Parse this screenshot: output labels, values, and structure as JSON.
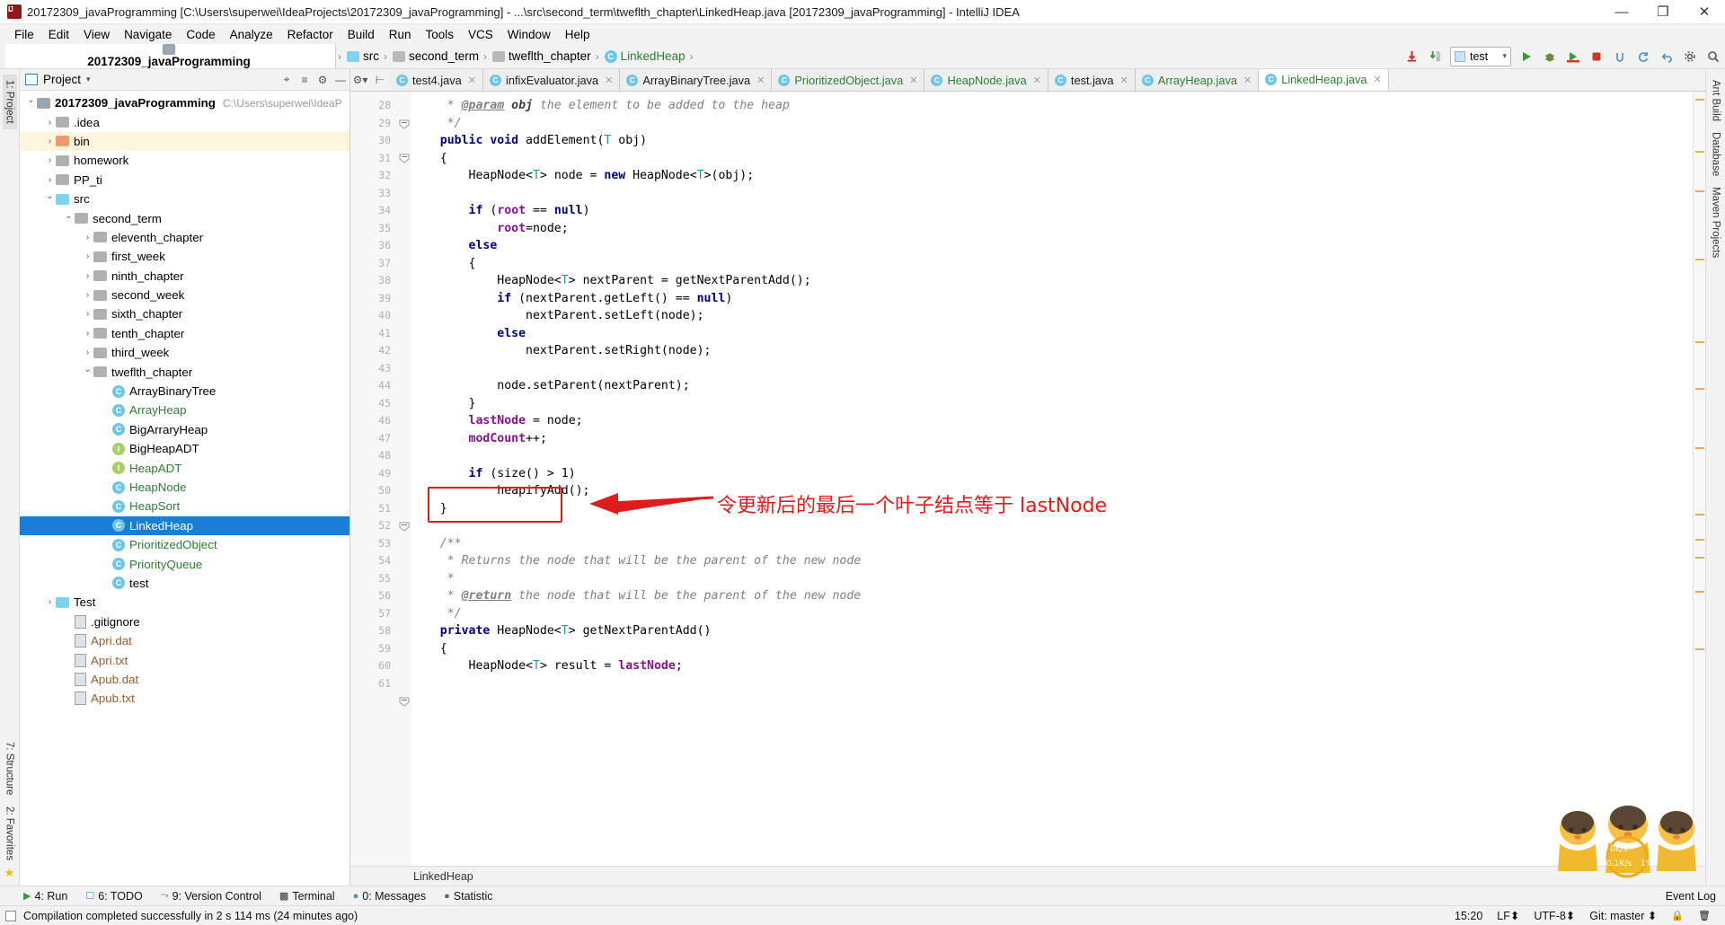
{
  "window": {
    "title": "20172309_javaProgramming [C:\\Users\\superwei\\IdeaProjects\\20172309_javaProgramming] - ...\\src\\second_term\\tweflth_chapter\\LinkedHeap.java [20172309_javaProgramming] - IntelliJ IDEA",
    "minimize": "—",
    "maximize": "❐",
    "close": "✕",
    "app_icon": "intellij-idea-icon"
  },
  "menu": [
    {
      "label": "File"
    },
    {
      "label": "Edit"
    },
    {
      "label": "View"
    },
    {
      "label": "Navigate"
    },
    {
      "label": "Code"
    },
    {
      "label": "Analyze"
    },
    {
      "label": "Refactor"
    },
    {
      "label": "Build"
    },
    {
      "label": "Run"
    },
    {
      "label": "Tools"
    },
    {
      "label": "VCS"
    },
    {
      "label": "Window"
    },
    {
      "label": "Help"
    }
  ],
  "navbar": {
    "crumbs": [
      {
        "label": "20172309_javaProgramming",
        "kind": "project"
      },
      {
        "label": "src",
        "kind": "source"
      },
      {
        "label": "second_term",
        "kind": "folder"
      },
      {
        "label": "tweflth_chapter",
        "kind": "folder"
      },
      {
        "label": "LinkedHeap",
        "kind": "class"
      }
    ],
    "separator": "›",
    "run_config": "test",
    "icons": [
      "update-project-icon",
      "commit-icon",
      "run-icon",
      "debug-icon",
      "run-with-coverage-icon",
      "stop-icon",
      "attach-profiler-icon",
      "sync-icon",
      "undo-icon",
      "settings-icon",
      "search-icon"
    ]
  },
  "left_rail": [
    {
      "label": "1: Project",
      "selected": true
    },
    {
      "label": "7: Structure",
      "selected": false
    },
    {
      "label": "2: Favorites",
      "selected": false
    }
  ],
  "right_rail": [
    {
      "label": "Ant Build"
    },
    {
      "label": "Database"
    },
    {
      "label": "Maven Projects"
    }
  ],
  "project_panel": {
    "title": "Project",
    "dropdown": "▾",
    "buttons": [
      "locate-icon",
      "collapse-all-icon",
      "settings-icon",
      "hide-icon"
    ],
    "tree": [
      {
        "depth": 0,
        "arrow": "open",
        "icon": "module",
        "label": "20172309_javaProgramming",
        "bold": true,
        "path": "C:\\Users\\superwei\\IdeaP"
      },
      {
        "depth": 1,
        "arrow": "closed",
        "icon": "folder-grey",
        "label": ".idea"
      },
      {
        "depth": 1,
        "arrow": "closed",
        "icon": "folder-orange",
        "label": "bin",
        "highlight": true
      },
      {
        "depth": 1,
        "arrow": "closed",
        "icon": "folder-grey",
        "label": "homework"
      },
      {
        "depth": 1,
        "arrow": "closed",
        "icon": "folder-grey",
        "label": "PP_ti"
      },
      {
        "depth": 1,
        "arrow": "open",
        "icon": "folder-src",
        "label": "src"
      },
      {
        "depth": 2,
        "arrow": "open",
        "icon": "folder-pkg",
        "label": "second_term"
      },
      {
        "depth": 3,
        "arrow": "closed",
        "icon": "folder-pkg",
        "label": "eleventh_chapter"
      },
      {
        "depth": 3,
        "arrow": "closed",
        "icon": "folder-pkg",
        "label": "first_week"
      },
      {
        "depth": 3,
        "arrow": "closed",
        "icon": "folder-pkg",
        "label": "ninth_chapter"
      },
      {
        "depth": 3,
        "arrow": "closed",
        "icon": "folder-pkg",
        "label": "second_week"
      },
      {
        "depth": 3,
        "arrow": "closed",
        "icon": "folder-pkg",
        "label": "sixth_chapter"
      },
      {
        "depth": 3,
        "arrow": "closed",
        "icon": "folder-pkg",
        "label": "tenth_chapter"
      },
      {
        "depth": 3,
        "arrow": "closed",
        "icon": "folder-pkg",
        "label": "third_week"
      },
      {
        "depth": 3,
        "arrow": "open",
        "icon": "folder-pkg",
        "label": "tweflth_chapter"
      },
      {
        "depth": 4,
        "arrow": "none",
        "icon": "class",
        "label": "ArrayBinaryTree"
      },
      {
        "depth": 4,
        "arrow": "none",
        "icon": "class",
        "label": "ArrayHeap",
        "green": true
      },
      {
        "depth": 4,
        "arrow": "none",
        "icon": "class",
        "label": "BigArraryHeap"
      },
      {
        "depth": 4,
        "arrow": "none",
        "icon": "interface",
        "label": "BigHeapADT"
      },
      {
        "depth": 4,
        "arrow": "none",
        "icon": "interface",
        "label": "HeapADT",
        "green": true
      },
      {
        "depth": 4,
        "arrow": "none",
        "icon": "class",
        "label": "HeapNode",
        "green": true
      },
      {
        "depth": 4,
        "arrow": "none",
        "icon": "class",
        "label": "HeapSort",
        "green": true
      },
      {
        "depth": 4,
        "arrow": "none",
        "icon": "class",
        "label": "LinkedHeap",
        "selected": true
      },
      {
        "depth": 4,
        "arrow": "none",
        "icon": "class",
        "label": "PrioritizedObject",
        "green": true
      },
      {
        "depth": 4,
        "arrow": "none",
        "icon": "class",
        "label": "PriorityQueue",
        "green": true
      },
      {
        "depth": 4,
        "arrow": "none",
        "icon": "class-runnable",
        "label": "test"
      },
      {
        "depth": 1,
        "arrow": "closed",
        "icon": "folder-src",
        "label": "Test"
      },
      {
        "depth": 2,
        "arrow": "none",
        "icon": "file",
        "label": ".gitignore"
      },
      {
        "depth": 2,
        "arrow": "none",
        "icon": "file",
        "label": "Apri.dat",
        "brown": true
      },
      {
        "depth": 2,
        "arrow": "none",
        "icon": "file",
        "label": "Apri.txt",
        "brown": true
      },
      {
        "depth": 2,
        "arrow": "none",
        "icon": "file",
        "label": "Apub.dat",
        "brown": true
      },
      {
        "depth": 2,
        "arrow": "none",
        "icon": "file",
        "label": "Apub.txt",
        "brown": true
      }
    ]
  },
  "editor_tabs": [
    {
      "label": "test4.java",
      "icon": "class-runnable",
      "green": false,
      "active": false
    },
    {
      "label": "infixEvaluator.java",
      "icon": "class",
      "green": false,
      "active": false
    },
    {
      "label": "ArrayBinaryTree.java",
      "icon": "class",
      "green": false,
      "active": false
    },
    {
      "label": "PrioritizedObject.java",
      "icon": "class",
      "green": true,
      "active": false
    },
    {
      "label": "HeapNode.java",
      "icon": "class",
      "green": true,
      "active": false
    },
    {
      "label": "test.java",
      "icon": "class-runnable",
      "green": false,
      "active": false
    },
    {
      "label": "ArrayHeap.java",
      "icon": "class",
      "green": true,
      "active": false
    },
    {
      "label": "LinkedHeap.java",
      "icon": "class",
      "green": true,
      "active": true
    }
  ],
  "code": {
    "first_line": 28,
    "lines": [
      {
        "n": 28,
        "html": "     <span class='cm'>* </span><span class='cmt'>@param</span><span class='cmb'> obj</span><span class='cm'> the element to be added to the heap</span>"
      },
      {
        "n": 29,
        "html": "     <span class='cm'>*/</span>"
      },
      {
        "n": 30,
        "html": "    <span class='kw'>public void</span> addElement(<span class='typ'>T</span> obj)"
      },
      {
        "n": 31,
        "html": "    {"
      },
      {
        "n": 32,
        "html": "        HeapNode&lt;<span class='typ'>T</span>&gt; node = <span class='kw'>new</span> HeapNode&lt;<span class='typ'>T</span>&gt;(obj);"
      },
      {
        "n": 33,
        "html": ""
      },
      {
        "n": 34,
        "html": "        <span class='kw'>if</span> (<span class='fld'>root</span> == <span class='kw'>null</span>)"
      },
      {
        "n": 35,
        "html": "            <span class='fld'>root</span>=node;"
      },
      {
        "n": 36,
        "html": "        <span class='kw'>else</span>"
      },
      {
        "n": 37,
        "html": "        {"
      },
      {
        "n": 38,
        "html": "            HeapNode&lt;<span class='typ'>T</span>&gt; nextParent = getNextParentAdd();"
      },
      {
        "n": 39,
        "html": "            <span class='kw'>if</span> (nextParent.getLeft() == <span class='kw'>null</span>)"
      },
      {
        "n": 40,
        "html": "                nextParent.setLeft(node);"
      },
      {
        "n": 41,
        "html": "            <span class='kw'>else</span>"
      },
      {
        "n": 42,
        "html": "                nextParent.setRight(node);"
      },
      {
        "n": 43,
        "html": ""
      },
      {
        "n": 44,
        "html": "            node.setParent(nextParent);"
      },
      {
        "n": 45,
        "html": "        }"
      },
      {
        "n": 46,
        "html": "        <span class='fld'>lastNode</span> = node;"
      },
      {
        "n": 47,
        "html": "        <span class='fld'>modCount</span>++;"
      },
      {
        "n": 48,
        "html": ""
      },
      {
        "n": 49,
        "html": "        <span class='kw'>if</span> (size() &gt; 1)"
      },
      {
        "n": 50,
        "html": "            heapifyAdd();"
      },
      {
        "n": 51,
        "html": "    }"
      },
      {
        "n": 52,
        "html": ""
      },
      {
        "n": 53,
        "html": "    <span class='cm'>/**</span>"
      },
      {
        "n": 54,
        "html": "     <span class='cm'>* Returns the node that will be the parent of the new node</span>"
      },
      {
        "n": 55,
        "html": "     <span class='cm'>*</span>"
      },
      {
        "n": 56,
        "html": "     <span class='cm'>* </span><span class='cmt'>@return</span><span class='cm'> the node that will be the parent of the new node</span>"
      },
      {
        "n": 57,
        "html": "     <span class='cm'>*/</span>"
      },
      {
        "n": 58,
        "html": "    <span class='kw'>private</span> HeapNode&lt;<span class='typ'>T</span>&gt; getNextParentAdd()"
      },
      {
        "n": 59,
        "html": "    {"
      },
      {
        "n": 60,
        "html": "        HeapNode&lt;<span class='typ'>T</span>&gt; result = <span class='fld'>lastNode</span>;"
      },
      {
        "n": 61,
        "html": ""
      }
    ]
  },
  "annotation": {
    "text": "令更新后的最后一个叶子结点等于 lastNode",
    "color": "#e11b1b",
    "boxed_code": "lastNode = node;"
  },
  "editor_footer": {
    "breadcrumb": "LinkedHeap"
  },
  "bottom_tools": [
    {
      "label": "4: Run",
      "key": "4",
      "icon": "run-icon"
    },
    {
      "label": "6: TODO",
      "key": "6",
      "icon": "todo-icon"
    },
    {
      "label": "9: Version Control",
      "key": "9",
      "icon": "vcs-icon"
    },
    {
      "label": "Terminal",
      "key": "T",
      "icon": "terminal-icon"
    },
    {
      "label": "0: Messages",
      "key": "0",
      "icon": "messages-icon"
    },
    {
      "label": "Statistic",
      "key": "",
      "icon": "statistic-icon"
    },
    {
      "label": "Event Log",
      "key": "",
      "icon": "event-log-icon"
    }
  ],
  "status_bar": {
    "message": "Compilation completed successfully in 2 s 114 ms (24 minutes ago)",
    "time": "15:20",
    "line_separator": "LF⬍",
    "encoding": "UTF-8⬍",
    "branch": "Git: master ⬍",
    "lock_icon": "lock-icon",
    "trash_icon": "trash-icon"
  },
  "mascot": {
    "up_speed": "0K/s",
    "down_speed": "0.1K/s",
    "cpu": "1%"
  },
  "colors": {
    "selection_blue": "#1a7fd4",
    "annotation_red": "#e11b1b",
    "green_text": "#2e7d32",
    "keyword_blue": "#000080",
    "field_purple": "#871094"
  }
}
